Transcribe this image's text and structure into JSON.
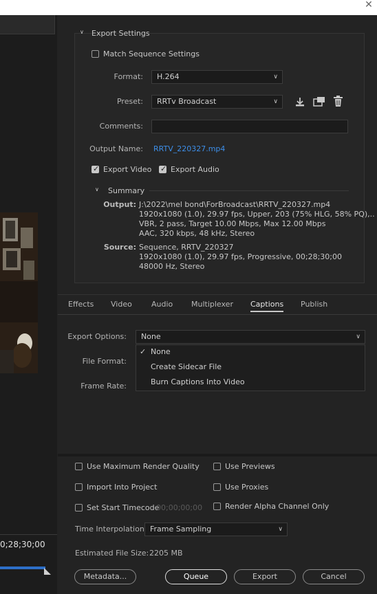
{
  "window": {
    "close_glyph": "✕"
  },
  "preview": {
    "timecode": "0;28;30;00"
  },
  "export_settings": {
    "header": "Export Settings",
    "match_sequence_label": "Match Sequence Settings",
    "format_label": "Format:",
    "format_value": "H.264",
    "preset_label": "Preset:",
    "preset_value": "RRTv Broadcast",
    "comments_label": "Comments:",
    "comments_value": "",
    "output_name_label": "Output Name:",
    "output_name_value": "RRTV_220327.mp4",
    "export_video_label": "Export Video",
    "export_audio_label": "Export Audio",
    "summary_header": "Summary",
    "output_label": "Output:",
    "output_lines": [
      "J:\\2022\\mel bond\\ForBroadcast\\RRTV_220327.mp4",
      "1920x1080 (1.0), 29.97 fps, Upper, 203 (75% HLG, 58% PQ),..",
      "VBR, 2 pass, Target 10.00 Mbps, Max 12.00 Mbps",
      "AAC, 320 kbps, 48 kHz, Stereo"
    ],
    "source_label": "Source:",
    "source_lines": [
      "Sequence, RRTV_220327",
      "1920x1080 (1.0), 29.97 fps, Progressive, 00;28;30;00",
      "48000 Hz, Stereo"
    ]
  },
  "tabs": [
    "Effects",
    "Video",
    "Audio",
    "Multiplexer",
    "Captions",
    "Publish"
  ],
  "captions": {
    "export_options_label": "Export Options:",
    "export_options_value": "None",
    "file_format_label": "File Format:",
    "frame_rate_label": "Frame Rate:",
    "options": [
      "None",
      "Create Sidecar File",
      "Burn Captions Into Video"
    ]
  },
  "bottom": {
    "use_max_render_quality": "Use Maximum Render Quality",
    "use_previews": "Use Previews",
    "import_into_project": "Import Into Project",
    "use_proxies": "Use Proxies",
    "set_start_timecode": "Set Start Timecode",
    "start_timecode_value": "00;00;00;00",
    "render_alpha": "Render Alpha Channel Only",
    "time_interpolation_label": "Time Interpolation:",
    "time_interpolation_value": "Frame Sampling",
    "estimated_size_label": "Estimated File Size:",
    "estimated_size_value": "2205 MB",
    "metadata_button": "Metadata...",
    "queue_button": "Queue",
    "export_button": "Export",
    "cancel_button": "Cancel"
  },
  "colors": {
    "accent_blue": "#3d8ee8",
    "panel_bg": "#232323"
  }
}
